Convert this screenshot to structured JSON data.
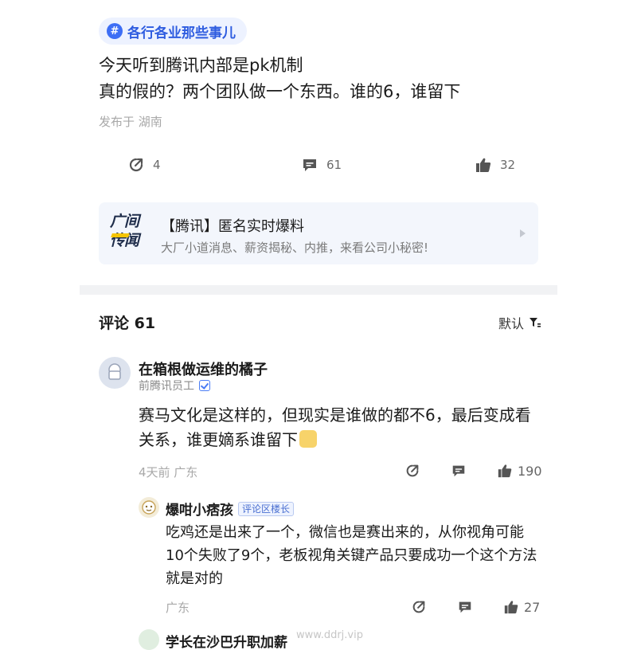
{
  "post": {
    "topic": "各行各业那些事儿",
    "topic_icon": "hash-icon",
    "line1": "今天听到腾讯内部是pk机制",
    "line2": "真的假的？两个团队做一个东西。谁的6，谁留下",
    "meta": "发布于 湖南",
    "actions": {
      "share_count": "4",
      "comment_count": "61",
      "like_count": "32"
    }
  },
  "promo": {
    "logo_line1": "广间",
    "logo_line2": "传闻",
    "title": "【腾讯】匿名实时爆料",
    "subtitle": "大厂小道消息、薪资揭秘、内推，来看公司小秘密!"
  },
  "comments_header": {
    "title": "评论 61",
    "sort_label": "默认"
  },
  "comments": [
    {
      "name": "在箱根做运维的橘子",
      "role": "前腾讯员工",
      "text": "赛马文化是这样的，但现实是谁做的都不6，最后变成看关系，谁更嫡系谁留下",
      "meta": "4天前  广东",
      "like_count": "190",
      "reply": {
        "name": "爆咁小痞孩",
        "badge": "评论区楼长",
        "text": "吃鸡还是出来了一个，微信也是赛出来的，从你视角可能10个失败了9个，老板视角关键产品只要成功一个这个方法就是对的",
        "meta": "广东",
        "like_count": "27"
      }
    },
    {
      "name": "学长在沙巴升职加薪"
    }
  ],
  "watermark": "www.ddrj.vip",
  "colors": {
    "accent": "#3d6ef5",
    "topic_bg": "#edf2ff",
    "promo_bg": "#f3f6fc",
    "divider": "#f1f2f4",
    "meta_text": "#a8a8a8"
  }
}
